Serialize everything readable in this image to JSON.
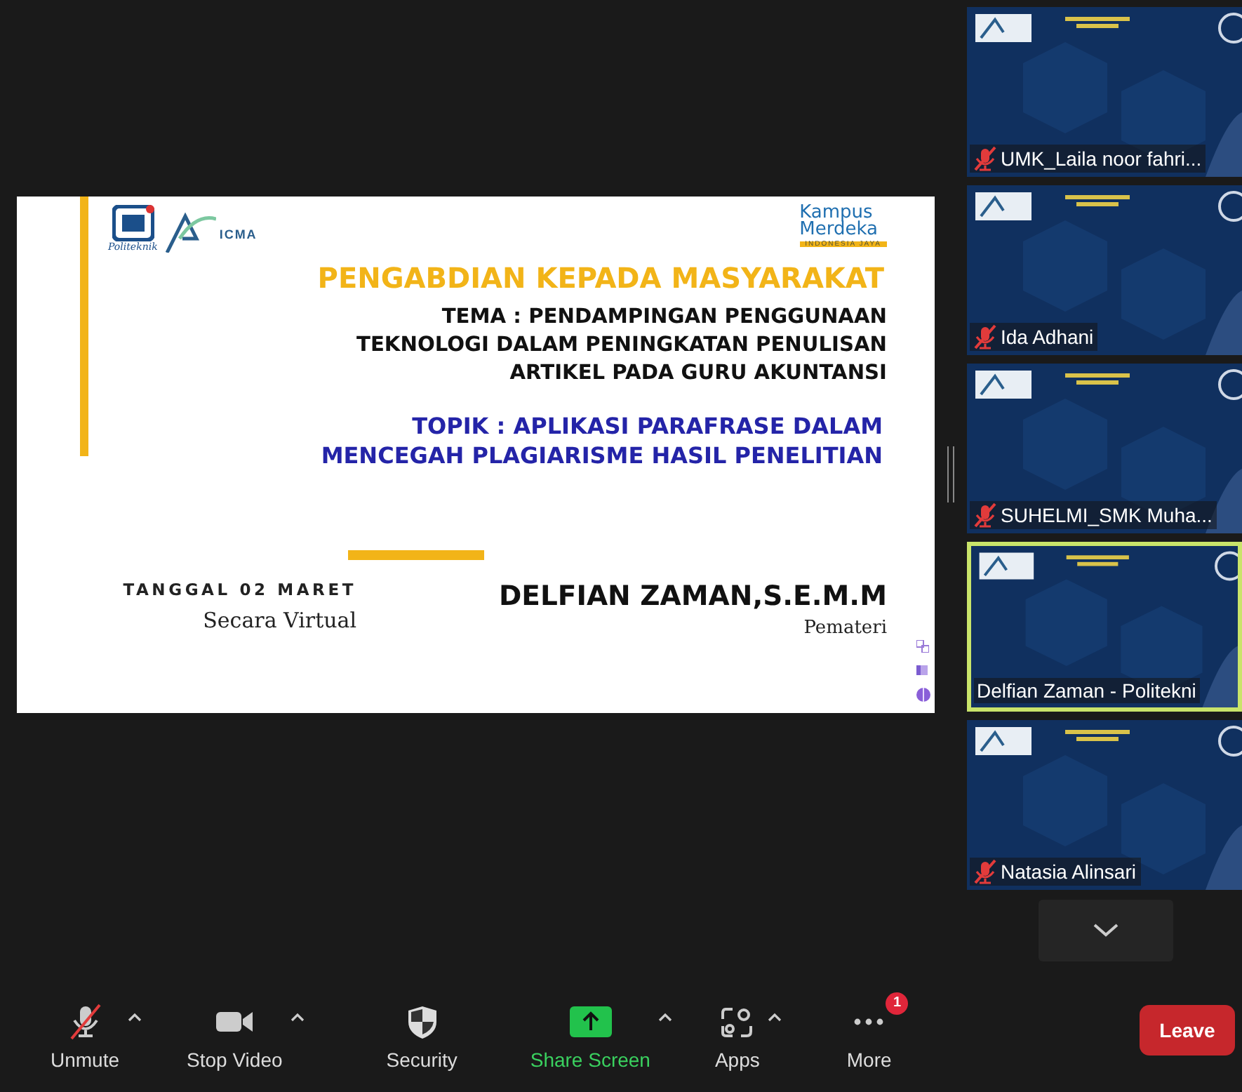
{
  "slide": {
    "logos": {
      "left_caption": "Politeknik",
      "partner": "ICMA",
      "right_line_1": "Kampus",
      "right_line_2": "Merdeka",
      "right_tagline": "INDONESIA JAYA"
    },
    "title": "PENGABDIAN KEPADA MASYARAKAT",
    "theme_lines": [
      "TEMA :  PENDAMPINGAN PENGGUNAAN",
      "TEKNOLOGI DALAM PENINGKATAN PENULISAN",
      "ARTIKEL PADA GURU AKUNTANSI"
    ],
    "topic_lines": [
      "TOPIK : APLIKASI PARAFRASE DALAM",
      "MENCEGAH PLAGIARISME HASIL PENELITIAN"
    ],
    "date": "TANGGAL 02 MARET",
    "mode": "Secara Virtual",
    "speaker": "DELFIAN ZAMAN,S.E.M.M",
    "speaker_role": "Pemateri"
  },
  "participants": [
    {
      "name": "UMK_Laila noor fahri...",
      "muted": true,
      "speaking": false
    },
    {
      "name": "Ida Adhani",
      "muted": true,
      "speaking": false
    },
    {
      "name": "SUHELMI_SMK Muha...",
      "muted": true,
      "speaking": false
    },
    {
      "name": "Delfian Zaman - Politekni",
      "muted": false,
      "speaking": true
    },
    {
      "name": "Natasia Alinsari",
      "muted": true,
      "speaking": false
    }
  ],
  "toolbar": [
    {
      "kind": "mic",
      "label": "Unmute",
      "muted": true,
      "caret": true
    },
    {
      "kind": "video",
      "label": "Stop Video",
      "caret": true
    },
    {
      "kind": "security",
      "label": "Security",
      "caret": false
    },
    {
      "kind": "share",
      "label": "Share Screen",
      "caret": true
    },
    {
      "kind": "apps",
      "label": "Apps",
      "caret": true
    },
    {
      "kind": "more",
      "label": "More",
      "caret": false,
      "badge": "1"
    }
  ],
  "leave_button": "Leave"
}
